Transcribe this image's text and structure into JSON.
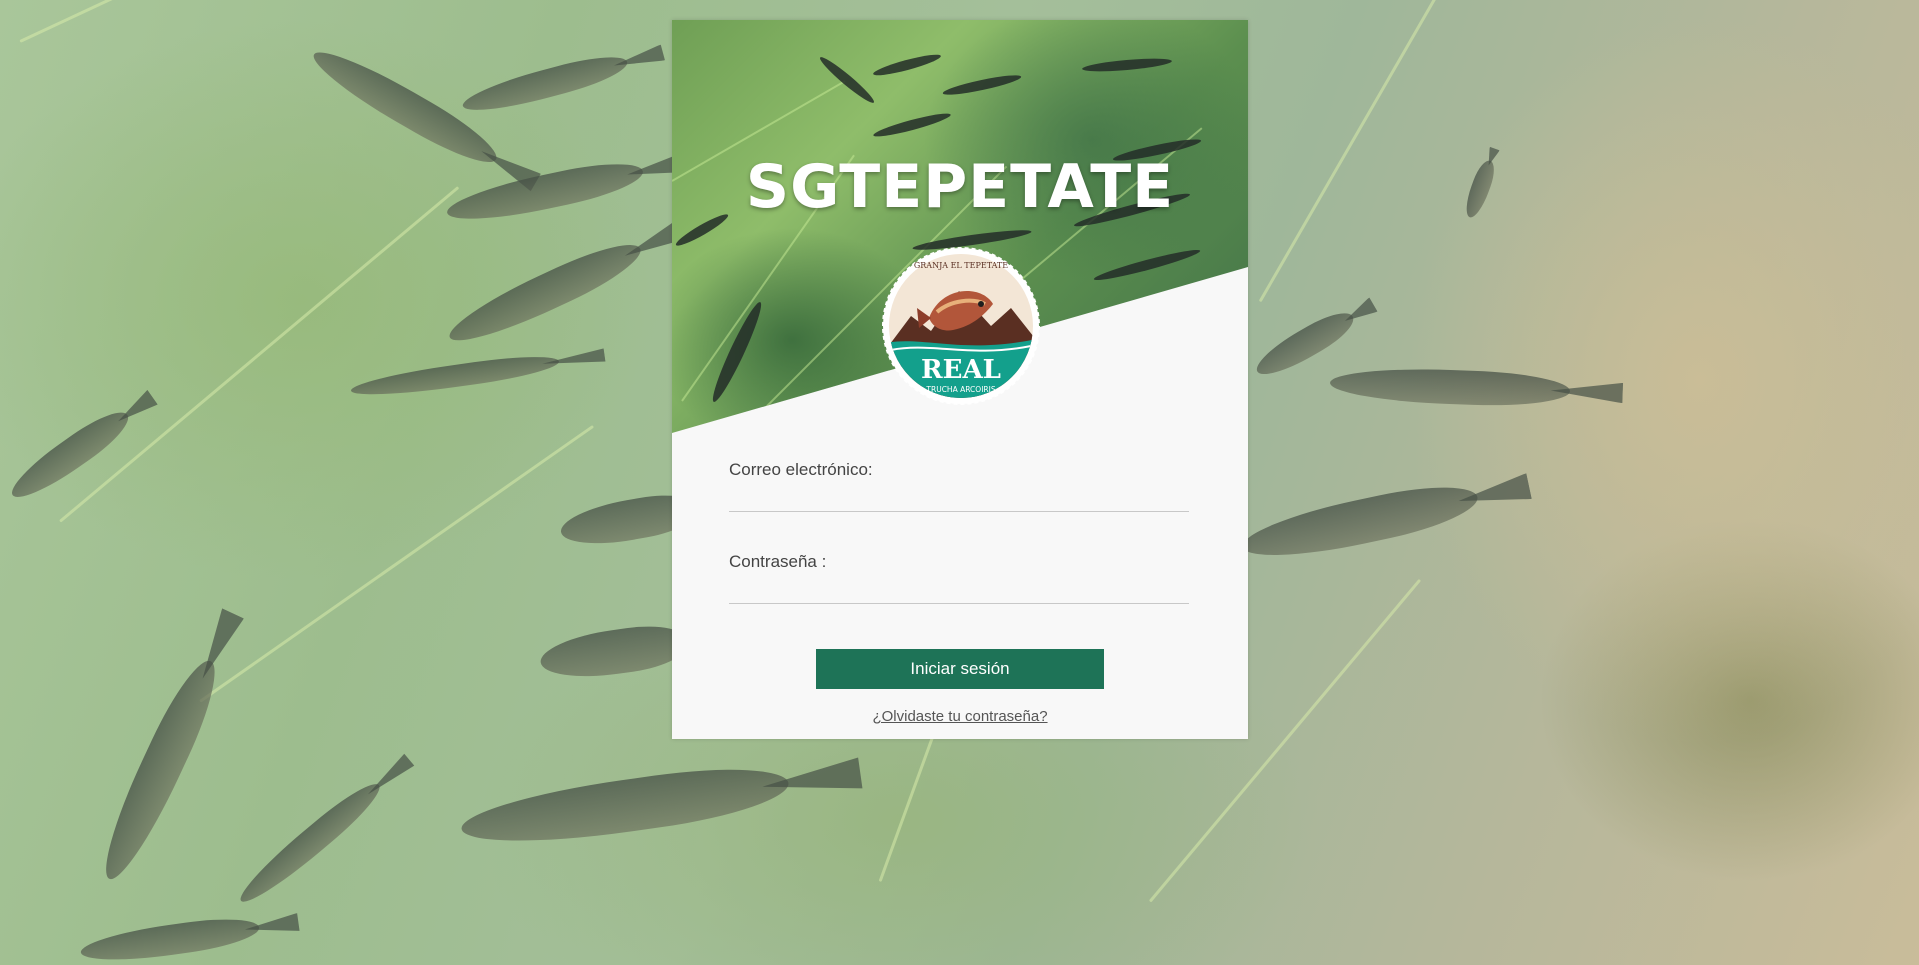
{
  "app": {
    "title": "SGTEPETATE"
  },
  "logo": {
    "top_text": "GRANJA EL TEPETATE",
    "brand": "REAL",
    "subtitle": "TRUCHA ARCOIRIS",
    "colors": {
      "badge": "#f3e6d6",
      "mountain": "#5a2f22",
      "water": "#13a08c"
    }
  },
  "form": {
    "email_label": "Correo electrónico:",
    "email_value": "",
    "password_label": "Contraseña :",
    "password_value": "",
    "submit_label": "Iniciar sesión",
    "forgot_label": "¿Olvidaste tu contraseña?"
  },
  "theme": {
    "primary": "#1e7357",
    "card_bg": "#f8f8f8"
  }
}
